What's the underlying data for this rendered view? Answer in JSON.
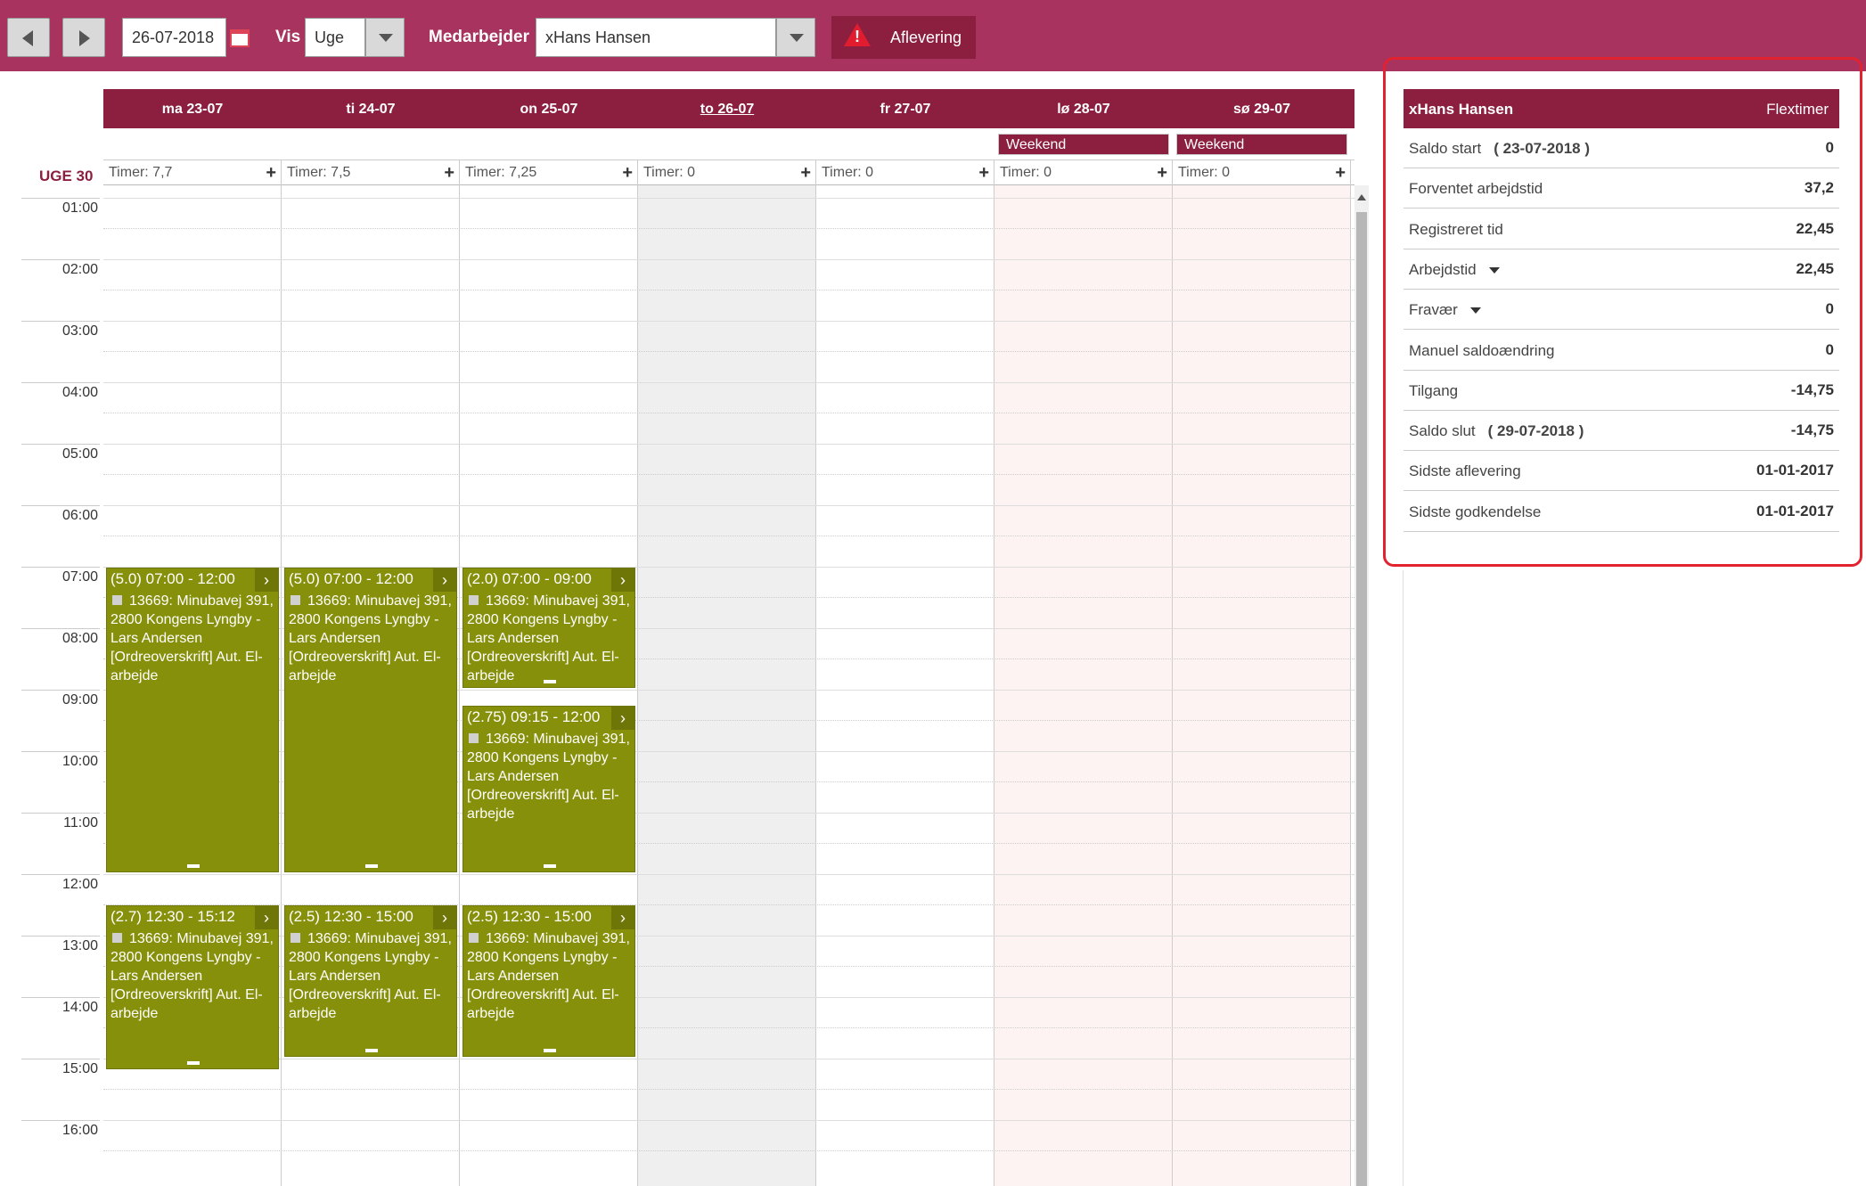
{
  "toolbar": {
    "date": "26-07-2018",
    "vis_label": "Vis",
    "vis_value": "Uge",
    "medarbejder_label": "Medarbejder",
    "medarbejder_value": "xHans Hansen",
    "aflevering_label": "Aflevering",
    "warning_mark": "!"
  },
  "calendar": {
    "week_label": "UGE 30",
    "days": [
      {
        "label": "ma 23-07",
        "timer": "Timer: 7,7"
      },
      {
        "label": "ti 24-07",
        "timer": "Timer: 7,5"
      },
      {
        "label": "on 25-07",
        "timer": "Timer: 7,25"
      },
      {
        "label": "to 26-07",
        "timer": "Timer: 0"
      },
      {
        "label": "fr 27-07",
        "timer": "Timer: 0"
      },
      {
        "label": "lø 28-07",
        "timer": "Timer: 0"
      },
      {
        "label": "sø 29-07",
        "timer": "Timer: 0"
      }
    ],
    "weekend_label": "Weekend",
    "hours": [
      "01:00",
      "02:00",
      "03:00",
      "04:00",
      "05:00",
      "06:00",
      "07:00",
      "08:00",
      "09:00",
      "10:00",
      "11:00",
      "12:00",
      "13:00",
      "14:00",
      "15:00",
      "16:00"
    ],
    "event_desc": "13669: Minubavej 391, 2800 Kongens Lyngby - Lars Andersen [Ordreoverskrift] Aut. El-arbejde",
    "events": [
      {
        "day": 0,
        "start": 7.0,
        "end": 12.0,
        "title": "(5.0) 07:00 - 12:00"
      },
      {
        "day": 1,
        "start": 7.0,
        "end": 12.0,
        "title": "(5.0) 07:00 - 12:00"
      },
      {
        "day": 2,
        "start": 7.0,
        "end": 9.0,
        "title": "(2.0) 07:00 - 09:00"
      },
      {
        "day": 2,
        "start": 9.25,
        "end": 12.0,
        "title": "(2.75) 09:15 - 12:00"
      },
      {
        "day": 0,
        "start": 12.5,
        "end": 15.2,
        "title": "(2.7) 12:30 - 15:12"
      },
      {
        "day": 1,
        "start": 12.5,
        "end": 15.0,
        "title": "(2.5) 12:30 - 15:00"
      },
      {
        "day": 2,
        "start": 12.5,
        "end": 15.0,
        "title": "(2.5) 12:30 - 15:00"
      }
    ]
  },
  "flex": {
    "name": "xHans Hansen",
    "title": "Flextimer",
    "rows": [
      {
        "label": "Saldo start",
        "date": "( 23-07-2018  )",
        "value": "0"
      },
      {
        "label": "Forventet arbejdstid",
        "value": "37,2"
      },
      {
        "label": "Registreret tid",
        "value": "22,45"
      },
      {
        "label": "Arbejdstid",
        "value": "22,45",
        "caret": true
      },
      {
        "label": "Fravær",
        "value": "0",
        "caret": true
      },
      {
        "label": "Manuel saldoændring",
        "value": "0"
      },
      {
        "label": "Tilgang",
        "value": "-14,75"
      },
      {
        "label": "Saldo slut",
        "date": "( 29-07-2018  )",
        "value": "-14,75"
      },
      {
        "label": "Sidste aflevering",
        "value": "01-01-2017"
      },
      {
        "label": "Sidste godkendelse",
        "value": "01-01-2017"
      }
    ]
  },
  "colors": {
    "toolbar": "#a8335f",
    "header": "#8c1f3f",
    "event": "#86900a",
    "highlight_border": "#e2222f"
  }
}
